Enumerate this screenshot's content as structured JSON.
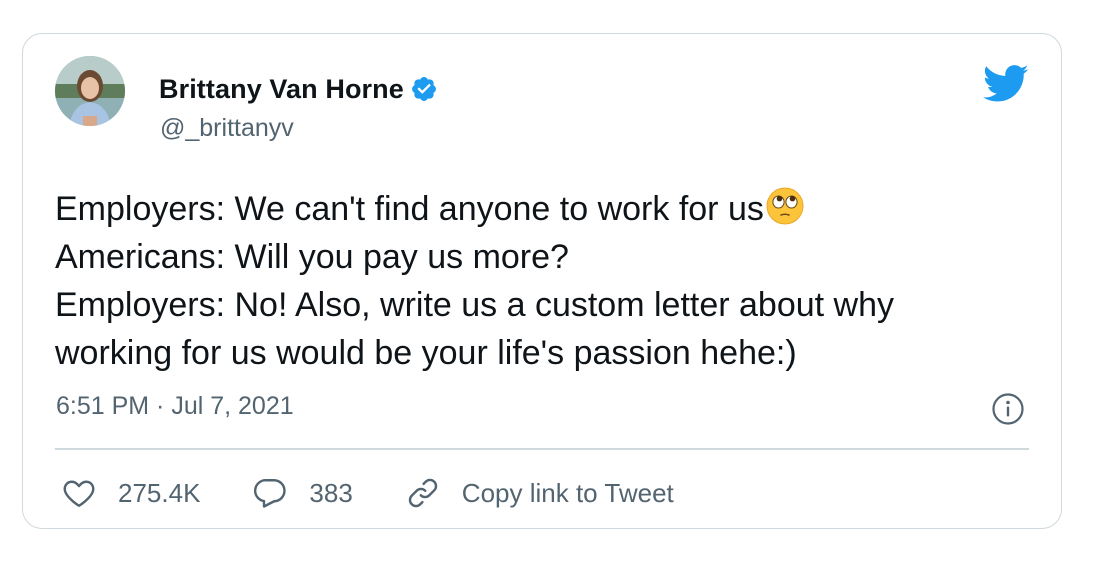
{
  "user": {
    "display_name": "Brittany Van Horne",
    "handle": "@_brittanyv",
    "verified": true
  },
  "tweet": {
    "lines": [
      "Employers: We can't find anyone to work for us",
      "Americans: Will you pay us more?",
      "Employers: No! Also, write us a custom letter about why",
      "working for us would be your life's passion hehe:)"
    ],
    "emoji": "eye-roll-emoji",
    "timestamp": "6:51 PM · Jul 7, 2021"
  },
  "actions": {
    "likes": "275.4K",
    "replies": "383",
    "copy_link": "Copy link to Tweet"
  },
  "colors": {
    "twitter_blue": "#1d9bf0",
    "text": "#0f1419",
    "secondary": "#536471",
    "border": "#cfd9de"
  },
  "icons": [
    "verified-badge-icon",
    "twitter-bird-icon",
    "info-icon",
    "heart-icon",
    "reply-icon",
    "link-icon"
  ]
}
